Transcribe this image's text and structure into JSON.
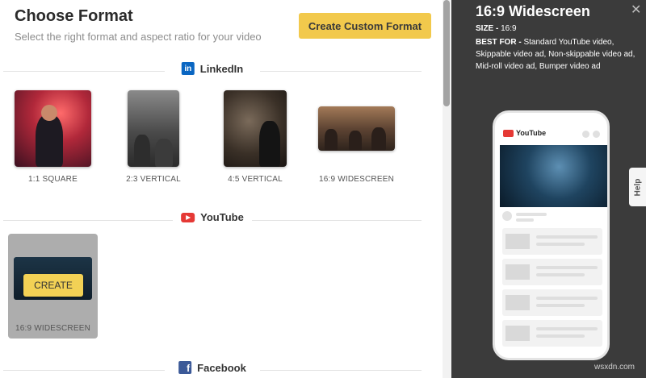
{
  "header": {
    "title": "Choose Format",
    "subtitle": "Select the right format and aspect ratio for your video",
    "custom_button": "Create Custom Format"
  },
  "sections": {
    "linkedin": {
      "label": "LinkedIn",
      "icon": "linkedin-icon"
    },
    "youtube": {
      "label": "YouTube",
      "icon": "youtube-icon"
    },
    "facebook": {
      "label": "Facebook",
      "icon": "facebook-icon"
    }
  },
  "linkedin_formats": [
    {
      "label": "1:1 SQUARE"
    },
    {
      "label": "2:3 VERTICAL"
    },
    {
      "label": "4:5 VERTICAL"
    },
    {
      "label": "16:9 WIDESCREEN"
    }
  ],
  "youtube_formats": [
    {
      "label": "16:9 WIDESCREEN",
      "action": "CREATE"
    }
  ],
  "preview": {
    "title": "16:9 Widescreen",
    "size_label": "SIZE -",
    "size_value": "16:9",
    "best_label": "BEST FOR -",
    "best_value": "Standard YouTube video, Skippable video ad, Non-skippable video ad, Mid-roll video ad, Bumper video ad",
    "phone_brand": "YouTube",
    "help_label": "Help"
  },
  "watermark": "wsxdn.com",
  "colors": {
    "accent_yellow": "#f2c94c",
    "panel_dark": "#3b3b3b",
    "linkedin_blue": "#0a66c2",
    "youtube_red": "#e53935",
    "facebook_blue": "#3b5998"
  }
}
